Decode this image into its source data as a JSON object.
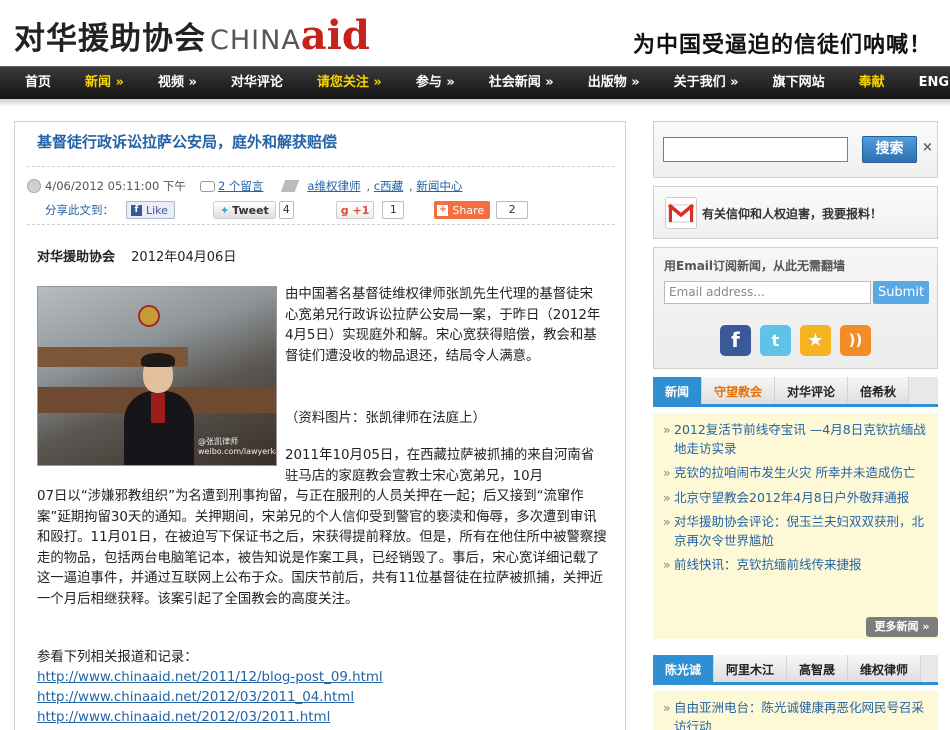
{
  "header": {
    "logo_cn": "对华援助协会",
    "logo_china": "CHINA",
    "logo_aid": "aid",
    "slogan": "为中国受逼迫的信徒们呐喊！"
  },
  "nav": [
    {
      "label": "首页",
      "highlight": false
    },
    {
      "label": "新闻 »",
      "highlight": true
    },
    {
      "label": "视频 »",
      "highlight": false
    },
    {
      "label": "对华评论",
      "highlight": false
    },
    {
      "label": "请您关注 »",
      "highlight": true
    },
    {
      "label": "参与 »",
      "highlight": false
    },
    {
      "label": "社会新闻 »",
      "highlight": false
    },
    {
      "label": "出版物 »",
      "highlight": false
    },
    {
      "label": "关于我们 »",
      "highlight": false
    },
    {
      "label": "旗下网站",
      "highlight": false
    },
    {
      "label": "奉献",
      "highlight": true
    },
    {
      "label": "ENG",
      "highlight": false
    }
  ],
  "article": {
    "title": "基督徒行政诉讼拉萨公安局，庭外和解获赔偿",
    "date": "4/06/2012 05:11:00 下午",
    "comments": "2 个留言",
    "tags": [
      "a维权律师",
      "c西藏",
      "新闻中心"
    ],
    "share_label": "分享此文到：",
    "like_label": "Like",
    "tweet_label": "Tweet",
    "tweet_count": "4",
    "plus_label": "+1",
    "plus_count": "1",
    "share_btn_label": "Share",
    "share_count": "2",
    "byline_org": "对华援助协会",
    "byline_date": "2012年04月06日",
    "photo_watermark": "@张凯律师\nweibo.com/lawyerkai",
    "para1": "由中国著名基督徒维权律师张凯先生代理的基督徒宋心宽弟兄行政诉讼拉萨公安局一案，于昨日（2012年4月5日）实现庭外和解。宋心宽获得赔偿，教会和基督徒们遭没收的物品退还，结局令人满意。",
    "caption": "（资料图片：张凯律师在法庭上）",
    "para2_line1": "2011年10月05日，在西藏拉萨被抓捕的来自河南省驻马店的家庭教会宣教士宋心宽弟兄，10月",
    "para2_rest": "07日以“涉嫌邪教组织”为名遭到刑事拘留，与正在服刑的人员关押在一起；后又接到“流窜作案”延期拘留30天的通知。关押期间，宋弟兄的个人信仰受到警官的亵渎和侮辱，多次遭到审讯和殴打。11月01日，在被迫写下保证书之后，宋获得提前释放。但是，所有在他住所中被警察搜走的物品，包括两台电脑笔记本，被告知说是作案工具，已经销毁了。事后，宋心宽详细记载了这一逼迫事件，并通过互联网上公布于众。国庆节前后，共有11位基督徒在拉萨被抓捕，关押近一个月后相继获释。该案引起了全国教会的高度关注。",
    "refs_label": "参看下列相关报道和记录：",
    "refs": [
      "http://www.chinaaid.net/2011/12/blog-post_09.html",
      "http://www.chinaaid.net/2012/03/2011_04.html",
      "http://www.chinaaid.net/2012/03/2011.html"
    ]
  },
  "sidebar": {
    "search_button": "搜索",
    "search_close": "×",
    "report_text": "有关信仰和人权迫害，我要报料！",
    "subscribe_title": "用Email订阅新闻，从此无需翻墙",
    "email_placeholder": "Email address...",
    "submit_label": "Submit",
    "tabs": [
      {
        "label": "新闻",
        "state": "active"
      },
      {
        "label": "守望教会",
        "state": "orange"
      },
      {
        "label": "对华评论",
        "state": ""
      },
      {
        "label": "倍希秋",
        "state": ""
      }
    ],
    "news": [
      "2012复活节前线夺宝讯 —4月8日克钦抗缅战地走访实录",
      "克钦的拉咱闹市发生火灾 所幸并未造成伤亡",
      "北京守望教会2012年4月8日户外敬拜通报",
      "对华援助协会评论：倪玉兰夫妇双双获刑，北京再次令世界尴尬",
      "前线快讯：克钦抗缅前线传来捷报"
    ],
    "more_label": "更多新闻 »",
    "tabs2": [
      {
        "label": "陈光诚",
        "state": "active"
      },
      {
        "label": "阿里木江",
        "state": ""
      },
      {
        "label": "高智晟",
        "state": ""
      },
      {
        "label": "维权律师",
        "state": ""
      }
    ],
    "news2": [
      "自由亚洲电台：陈光诚健康再恶化网民号召采访行动"
    ]
  },
  "colors": {
    "accent_blue": "#2463a5",
    "nav_highlight": "#f7d400",
    "brand_red": "#c8201b",
    "tab_blue": "#2f8fd3"
  }
}
